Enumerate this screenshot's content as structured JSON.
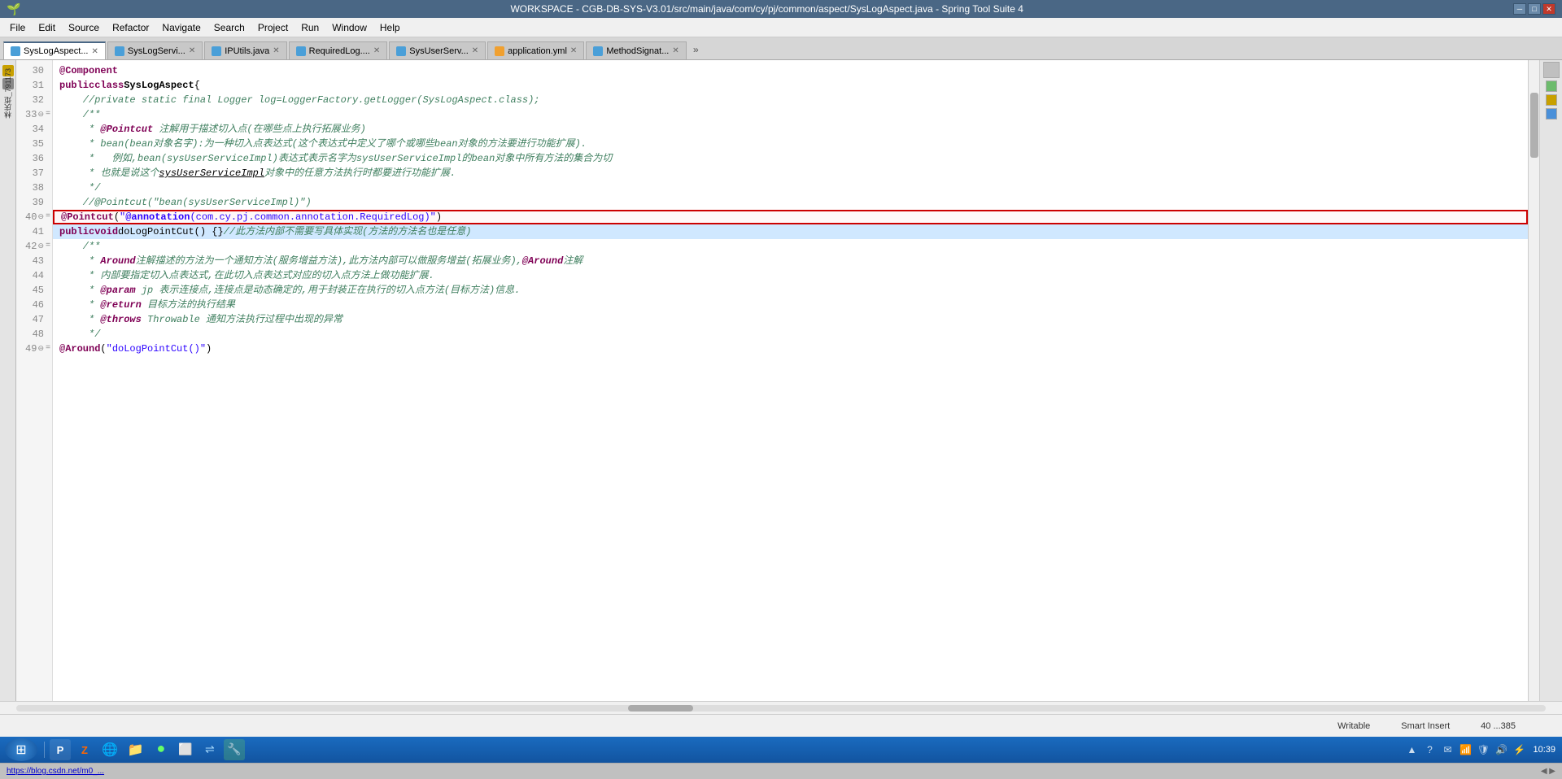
{
  "titleBar": {
    "title": "WORKSPACE - CGB-DB-SYS-V3.01/src/main/java/com/cy/pj/common/aspect/SysLogAspect.java - Spring Tool Suite 4",
    "minimizeLabel": "─",
    "maximizeLabel": "□",
    "closeLabel": "✕"
  },
  "menuBar": {
    "items": [
      "File",
      "Edit",
      "Source",
      "Refactor",
      "Navigate",
      "Search",
      "Project",
      "Run",
      "Window",
      "Help"
    ]
  },
  "tabs": [
    {
      "label": "SysLogAspect...",
      "icon": "java-icon",
      "active": true
    },
    {
      "label": "SysLogServi...",
      "icon": "java-icon",
      "active": false
    },
    {
      "label": "IPUtils.java",
      "icon": "java-icon",
      "active": false
    },
    {
      "label": "RequiredLog....",
      "icon": "java-icon",
      "active": false
    },
    {
      "label": "SysUserServ...",
      "icon": "java-icon",
      "active": false
    },
    {
      "label": "application.yml",
      "icon": "yaml-icon",
      "active": false
    },
    {
      "label": "MethodSignat...",
      "icon": "java-icon",
      "active": false
    }
  ],
  "codeLines": [
    {
      "num": "30",
      "marker": false,
      "content": "@Component"
    },
    {
      "num": "31",
      "marker": false,
      "content": "public class SysLogAspect {"
    },
    {
      "num": "32",
      "marker": false,
      "content": "    //private static final Logger log=LoggerFactory.getLogger(SysLogAspect.class);"
    },
    {
      "num": "33",
      "marker": true,
      "content": "    /**"
    },
    {
      "num": "34",
      "marker": false,
      "content": "     * @Pointcut 注解用于描述切入点(在哪些点上执行拓展业务)"
    },
    {
      "num": "35",
      "marker": false,
      "content": "     * bean(bean对象名字):为一种切入点表达式(这个表达式中定义了哪个或哪些bean对象的方法要进行功能扩展)."
    },
    {
      "num": "36",
      "marker": false,
      "content": "     *   例如,bean(sysUserServiceImpl)表达式表示名字为sysUserServiceImpl的bean对象中所有方法的集合为切"
    },
    {
      "num": "37",
      "marker": false,
      "content": "     * 也就是说这个sysUserServiceImpl对象中的任意方法执行时都要进行功能扩展."
    },
    {
      "num": "38",
      "marker": false,
      "content": "     */"
    },
    {
      "num": "39",
      "marker": false,
      "content": "    //@Pointcut(\"bean(sysUserServiceImpl)\")"
    },
    {
      "num": "40",
      "marker": true,
      "content": "    @Pointcut(\"@annotation(com.cy.pj.common.annotation.RequiredLog)\")"
    },
    {
      "num": "41",
      "marker": false,
      "content": "    public void doLogPointCut() {}//此方法内部不需要写具体实现(方法的方法名也是任意)"
    },
    {
      "num": "42",
      "marker": true,
      "content": "    /**"
    },
    {
      "num": "43",
      "marker": false,
      "content": "     * Around注解描述的方法为一个通知方法(服务增益方法),此方法内部可以做服务增益(拓展业务),@Around注解"
    },
    {
      "num": "44",
      "marker": false,
      "content": "     * 内部要指定切入点表达式,在此切入点表达式对应的切入点方法上做功能扩展."
    },
    {
      "num": "45",
      "marker": false,
      "content": "     * @param jp 表示连接点,连接点是动态确定的,用于封装正在执行的切入点方法(目标方法)信息."
    },
    {
      "num": "46",
      "marker": false,
      "content": "     * @return 目标方法的执行结果"
    },
    {
      "num": "47",
      "marker": false,
      "content": "     * @throws Throwable 通知方法执行过程中出现的异常"
    },
    {
      "num": "48",
      "marker": false,
      "content": "     */"
    },
    {
      "num": "49",
      "marker": true,
      "content": "    @Around(\"doLogPointCut()\")"
    }
  ],
  "statusBar": {
    "writable": "Writable",
    "insertMode": "Smart Insert",
    "position": "40 ...385"
  },
  "taskbar": {
    "time": "10:39",
    "apps": [
      "P",
      "Z",
      "🌐",
      "📁",
      "●",
      "⬜",
      "⇌",
      "🔧"
    ]
  },
  "userLabel": "林庆炬_791173"
}
